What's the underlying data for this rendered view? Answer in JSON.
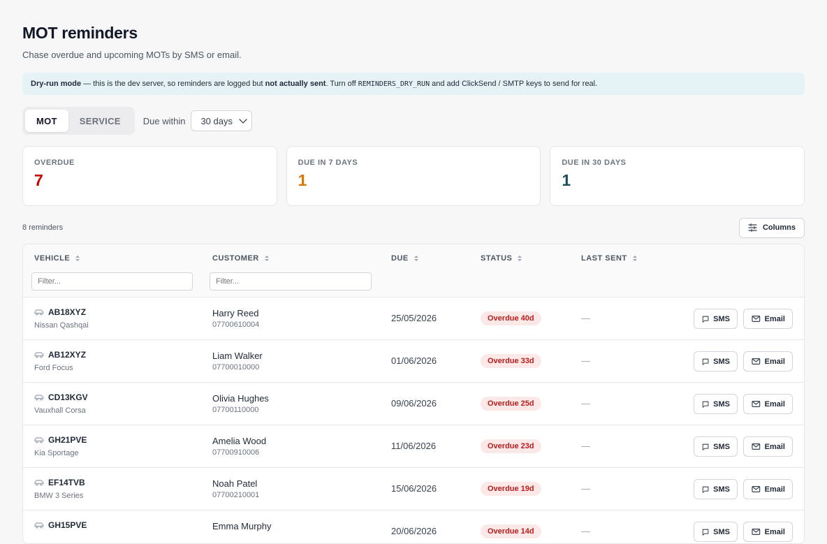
{
  "header": {
    "title": "MOT reminders",
    "subtitle": "Chase overdue and upcoming MOTs by SMS or email."
  },
  "banner": {
    "mode": "Dry-run mode",
    "text1": " — this is the dev server, so reminders are logged but ",
    "emph": "not actually sent",
    "text2": ". Turn off ",
    "code": "REMINDERS_DRY_RUN",
    "text3": " and add ClickSend / SMTP keys to send for real."
  },
  "toolbar": {
    "tabs": [
      {
        "label": "MOT",
        "active": true
      },
      {
        "label": "SERVICE",
        "active": false
      }
    ],
    "due_label": "Due within",
    "due_value": "30 days"
  },
  "stats": [
    {
      "label": "Overdue",
      "value": "7",
      "color": "#cc0000"
    },
    {
      "label": "Due in 7 days",
      "value": "1",
      "color": "#d97706"
    },
    {
      "label": "Due in 30 days",
      "value": "1",
      "color": "#1e4d5c"
    }
  ],
  "list": {
    "count_text": "8 reminders",
    "columns_label": "Columns"
  },
  "table": {
    "headers": {
      "vehicle": "VEHICLE",
      "customer": "CUSTOMER",
      "due": "DUE",
      "status": "STATUS",
      "last_sent": "LAST SENT"
    },
    "filter_placeholder": "Filter...",
    "sms_label": "SMS",
    "email_label": "Email",
    "rows": [
      {
        "reg": "AB18XYZ",
        "model": "Nissan Qashqai",
        "name": "Harry Reed",
        "phone": "07700610004",
        "due": "25/05/2026",
        "status": "Overdue 40d",
        "last_sent": "—"
      },
      {
        "reg": "AB12XYZ",
        "model": "Ford Focus",
        "name": "Liam Walker",
        "phone": "07700010000",
        "due": "01/06/2026",
        "status": "Overdue 33d",
        "last_sent": "—"
      },
      {
        "reg": "CD13KGV",
        "model": "Vauxhall Corsa",
        "name": "Olivia Hughes",
        "phone": "07700110000",
        "due": "09/06/2026",
        "status": "Overdue 25d",
        "last_sent": "—"
      },
      {
        "reg": "GH21PVE",
        "model": "Kia Sportage",
        "name": "Amelia Wood",
        "phone": "07700910006",
        "due": "11/06/2026",
        "status": "Overdue 23d",
        "last_sent": "—"
      },
      {
        "reg": "EF14TVB",
        "model": "BMW 3 Series",
        "name": "Noah Patel",
        "phone": "07700210001",
        "due": "15/06/2026",
        "status": "Overdue 19d",
        "last_sent": "—"
      },
      {
        "reg": "GH15PVE",
        "model": "",
        "name": "Emma Murphy",
        "phone": "",
        "due": "20/06/2026",
        "status": "Overdue 14d",
        "last_sent": "—"
      }
    ]
  }
}
